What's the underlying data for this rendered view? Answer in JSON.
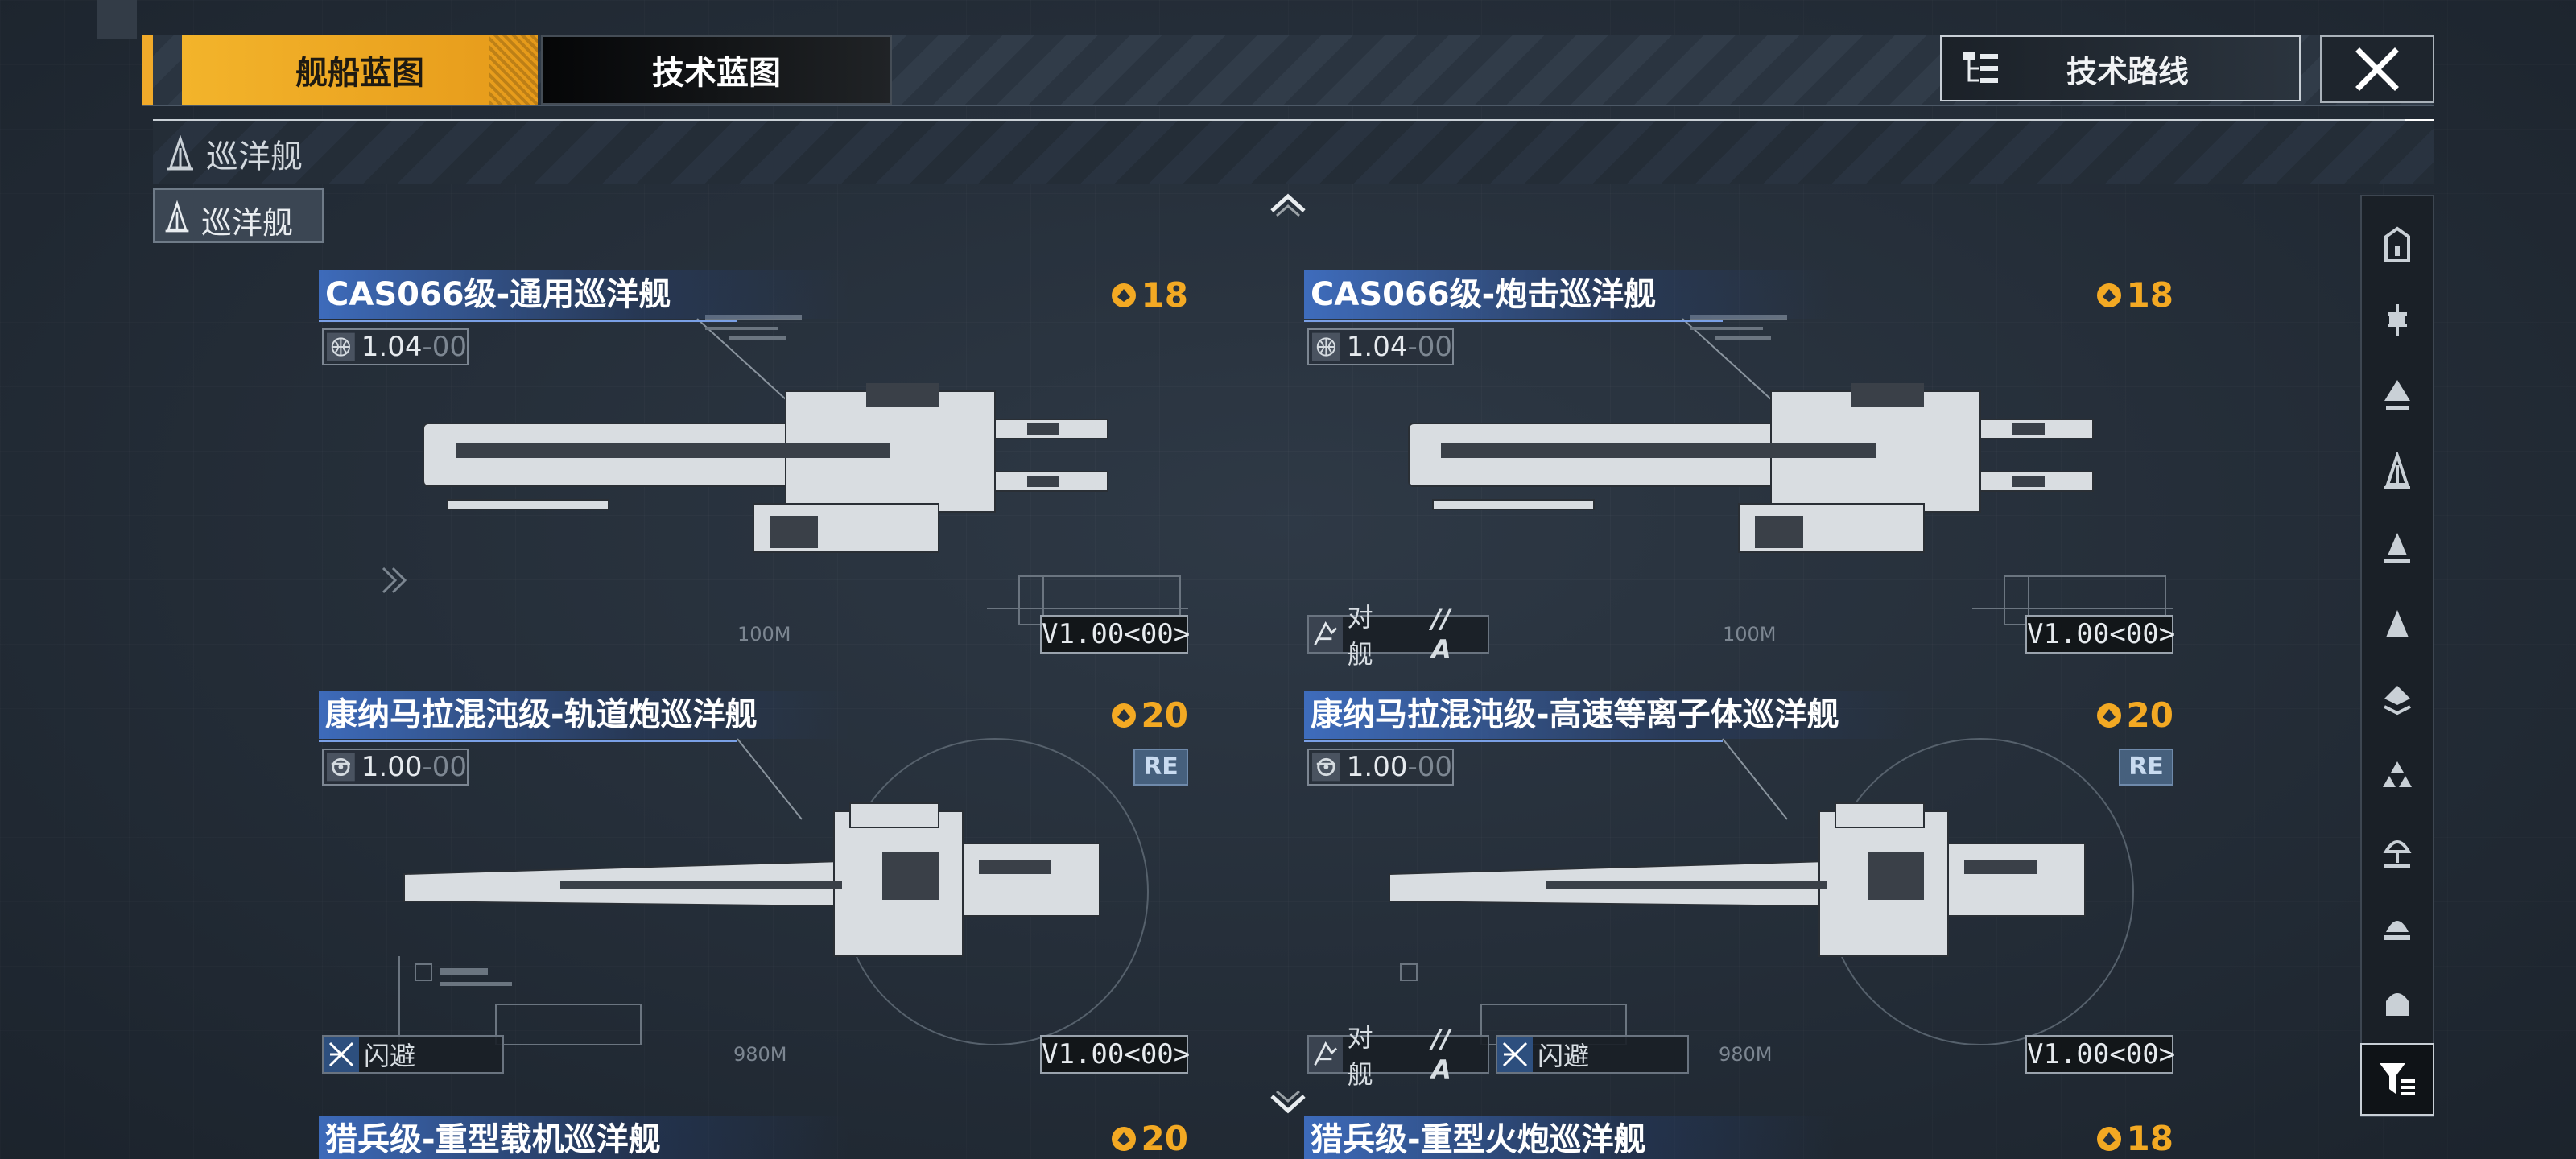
{
  "header": {
    "tabs": [
      {
        "label": "舰船蓝图",
        "active": true
      },
      {
        "label": "技术蓝图",
        "active": false
      }
    ],
    "route_button": "技术路线",
    "close_icon": "close-icon"
  },
  "category": {
    "label": "巡洋舰",
    "subtab": "巡洋舰"
  },
  "cards": [
    {
      "name": "CAS066级-通用巡洋舰",
      "cost": "18",
      "version": "1.04",
      "version_suffix": "-00",
      "version_icon": "globe-icon",
      "code": "V1.00<00>",
      "distance": "100M",
      "re": false,
      "tags": []
    },
    {
      "name": "CAS066级-炮击巡洋舰",
      "cost": "18",
      "version": "1.04",
      "version_suffix": "-00",
      "version_icon": "globe-icon",
      "code": "V1.00<00>",
      "distance": "100M",
      "re": false,
      "tags": [
        {
          "label": "对舰",
          "suffix": "// A"
        }
      ]
    },
    {
      "name": "康纳马拉混沌级-轨道炮巡洋舰",
      "cost": "20",
      "version": "1.00",
      "version_suffix": "-00",
      "version_icon": "gear-icon",
      "code": "V1.00<00>",
      "distance": "980M",
      "re": true,
      "re_label": "RE",
      "tags": [
        {
          "label": "闪避",
          "suffix": ""
        }
      ]
    },
    {
      "name": "康纳马拉混沌级-高速等离子体巡洋舰",
      "cost": "20",
      "version": "1.00",
      "version_suffix": "-00",
      "version_icon": "gear-icon",
      "code": "V1.00<00>",
      "distance": "980M",
      "re": true,
      "re_label": "RE",
      "tags": [
        {
          "label": "对舰",
          "suffix": "// A"
        },
        {
          "label": "闪避",
          "suffix": ""
        }
      ]
    }
  ],
  "peek_cards": [
    {
      "name": "猎兵级-重型载机巡洋舰",
      "cost": "20"
    },
    {
      "name": "猎兵级-重型火炮巡洋舰",
      "cost": "18"
    }
  ],
  "filter_icons": [
    "ship-class-1-icon",
    "ship-class-2-icon",
    "ship-class-3-icon",
    "ship-class-4-icon",
    "ship-class-5-icon",
    "ship-class-6-icon",
    "ship-class-7-icon",
    "ship-class-8-icon",
    "ship-class-9-icon",
    "ship-class-10-icon",
    "ship-class-11-icon"
  ],
  "colors": {
    "accent": "#f1aa2a",
    "title_blue": "#4276d2",
    "cost": "#f3a923"
  }
}
